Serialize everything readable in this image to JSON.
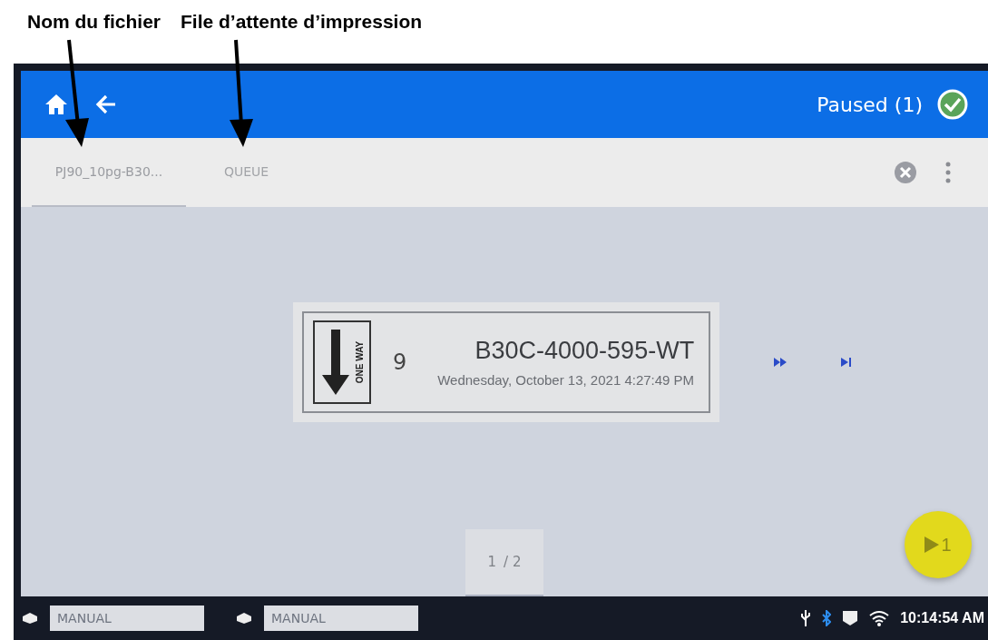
{
  "callouts": [
    {
      "label": "Nom du fichier"
    },
    {
      "label": "File d’attente d’impression"
    }
  ],
  "header": {
    "status": "Paused (1)"
  },
  "tabs": [
    {
      "label": "PJ90_10pg-B30...",
      "selected": true
    },
    {
      "label": "QUEUE",
      "selected": false
    }
  ],
  "job": {
    "sign_text": "ONE WAY",
    "count": "9",
    "name": "B30C-4000-595-WT",
    "date": "Wednesday, October 13, 2021 4:27:49 PM"
  },
  "pager": {
    "current": "1",
    "total": "/ 2"
  },
  "print_button": {
    "label": "1"
  },
  "status_bar": {
    "fields": [
      {
        "value": "MANUAL"
      },
      {
        "value": "MANUAL"
      }
    ],
    "time": "10:14:54 AM"
  }
}
